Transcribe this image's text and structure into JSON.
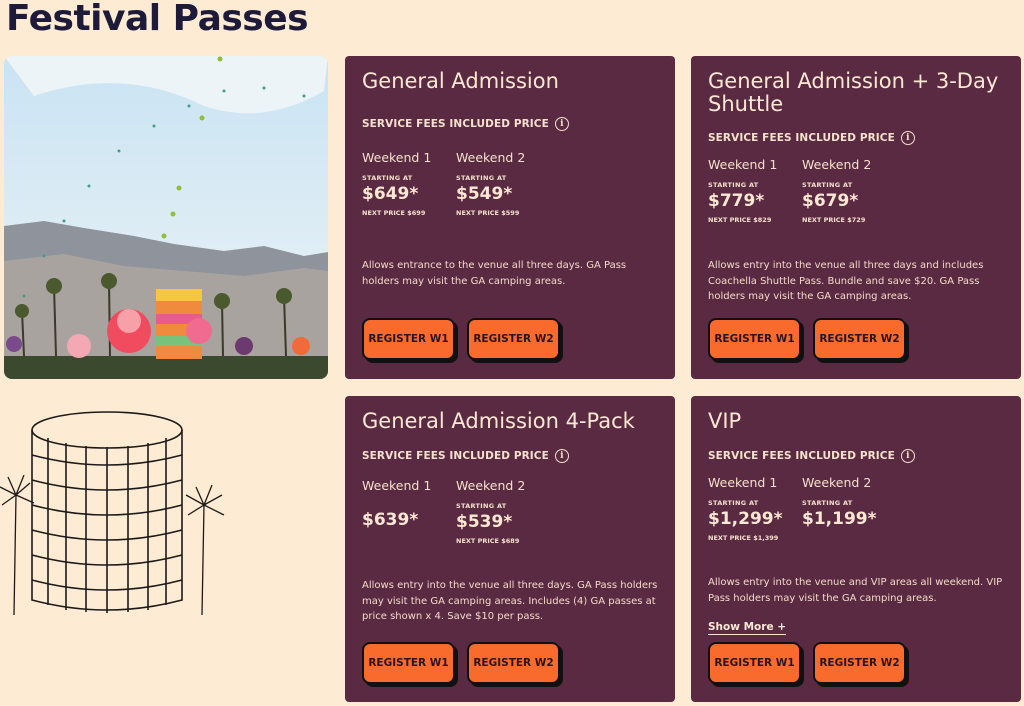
{
  "page": {
    "title": "Festival Passes"
  },
  "common": {
    "fees_label": "SERVICE FEES INCLUDED PRICE",
    "info_glyph": "i",
    "starting_at": "STARTING AT",
    "weekend1": "Weekend 1",
    "weekend2": "Weekend 2",
    "register_w1": "REGISTER W1",
    "register_w2": "REGISTER W2",
    "show_more": "Show More +"
  },
  "cards": [
    {
      "title": "General Admission",
      "w1_price": "$649*",
      "w1_next": "NEXT PRICE $699",
      "w2_price": "$549*",
      "w2_next": "NEXT PRICE $599",
      "description": "Allows entrance to the venue all three days. GA Pass holders may visit the GA camping areas."
    },
    {
      "title": "General Admission + 3-Day Shuttle",
      "w1_price": "$779*",
      "w1_next": "NEXT PRICE $829",
      "w2_price": "$679*",
      "w2_next": "NEXT PRICE $729",
      "description": "Allows entry into the venue all three days and includes Coachella Shuttle Pass. Bundle and save $20. GA Pass holders may visit the GA camping areas."
    },
    {
      "title": "General Admission 4-Pack",
      "w1_price": "$639*",
      "w2_price": "$539*",
      "w2_next": "NEXT PRICE $689",
      "description": "Allows entry into the venue all three days. GA Pass holders may visit the GA camping areas. Includes (4) GA passes at price shown x 4. Save $10 per pass."
    },
    {
      "title": "VIP",
      "w1_price": "$1,299*",
      "w1_next": "NEXT PRICE $1,399",
      "w2_price": "$1,199*",
      "description": "Allows entry into the venue and VIP areas all weekend. VIP Pass holders may visit the GA camping areas."
    }
  ],
  "colors": {
    "background": "#fdebd3",
    "card": "#5a2a42",
    "button": "#f86b2c",
    "title": "#1e1b3a"
  },
  "icons": [
    "info-icon",
    "festival-photo",
    "building-sketch-illustration",
    "palm-tree-icon"
  ]
}
